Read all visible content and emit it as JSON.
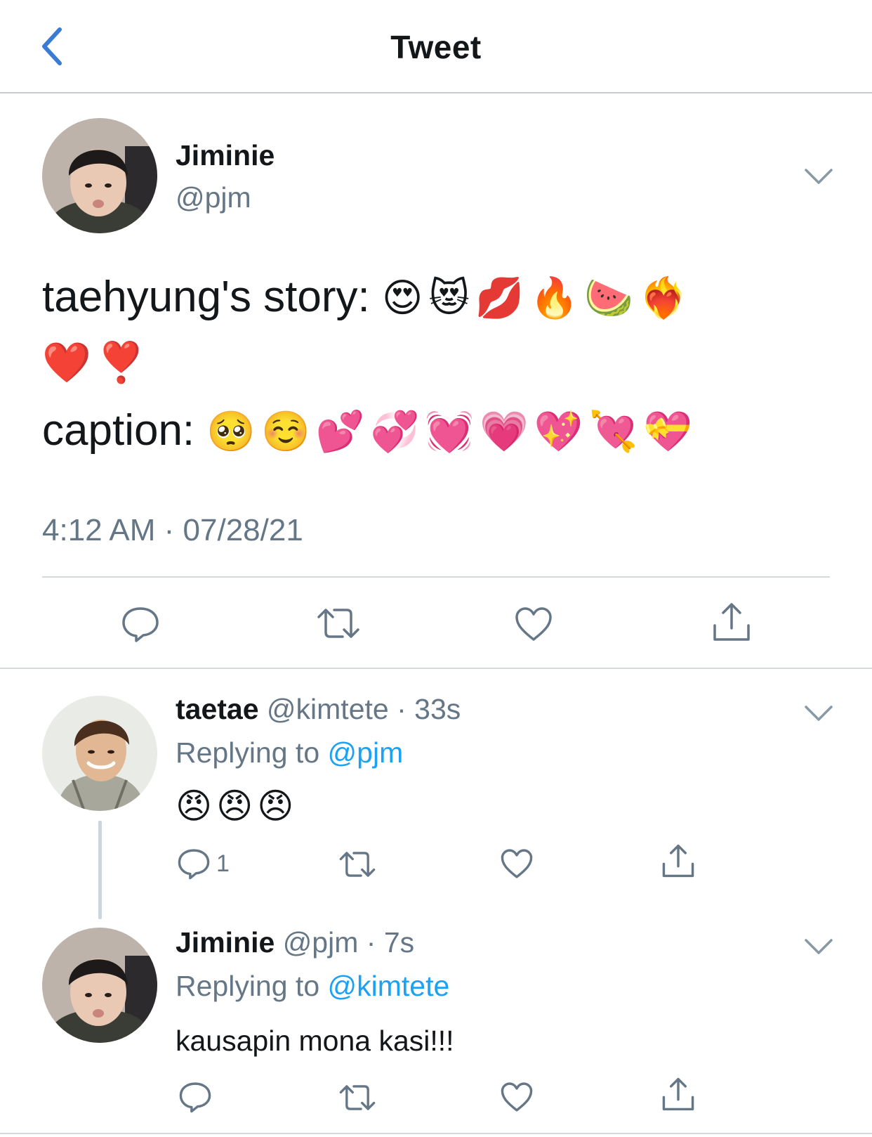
{
  "header": {
    "title": "Tweet"
  },
  "main_tweet": {
    "name": "Jiminie",
    "handle": "@pjm",
    "story_label": "taehyung's story:",
    "story_emojis_line1": "😍😻💋🔥🍉❤️‍🔥",
    "story_emojis_line2": "❤️❣️",
    "caption_label": "caption:",
    "caption_emojis": "🥺☺️💕💞💓💗💖💘💝",
    "timestamp": "4:12 AM · 07/28/21"
  },
  "replies": [
    {
      "name": "taetae",
      "handle": "@kimtete",
      "time": "· 33s",
      "replying_prefix": "Replying to",
      "replying_to": "@pjm",
      "emojis": "😠😠😠",
      "reply_count": "1"
    },
    {
      "name": "Jiminie",
      "handle": "@pjm",
      "time": "· 7s",
      "replying_prefix": "Replying to",
      "replying_to": "@kimtete",
      "text": "kausapin mona kasi!!!"
    }
  ],
  "icons": {
    "back": "chevron-left-icon",
    "more": "chevron-down-icon",
    "reply": "comment-bubble-icon",
    "retweet": "retweet-icon",
    "like": "heart-icon",
    "share": "share-upload-icon"
  },
  "colors": {
    "accent": "#1da1f2",
    "back_arrow": "#3a7bd5",
    "secondary_text": "#657786",
    "divider": "#d5d9dd"
  }
}
